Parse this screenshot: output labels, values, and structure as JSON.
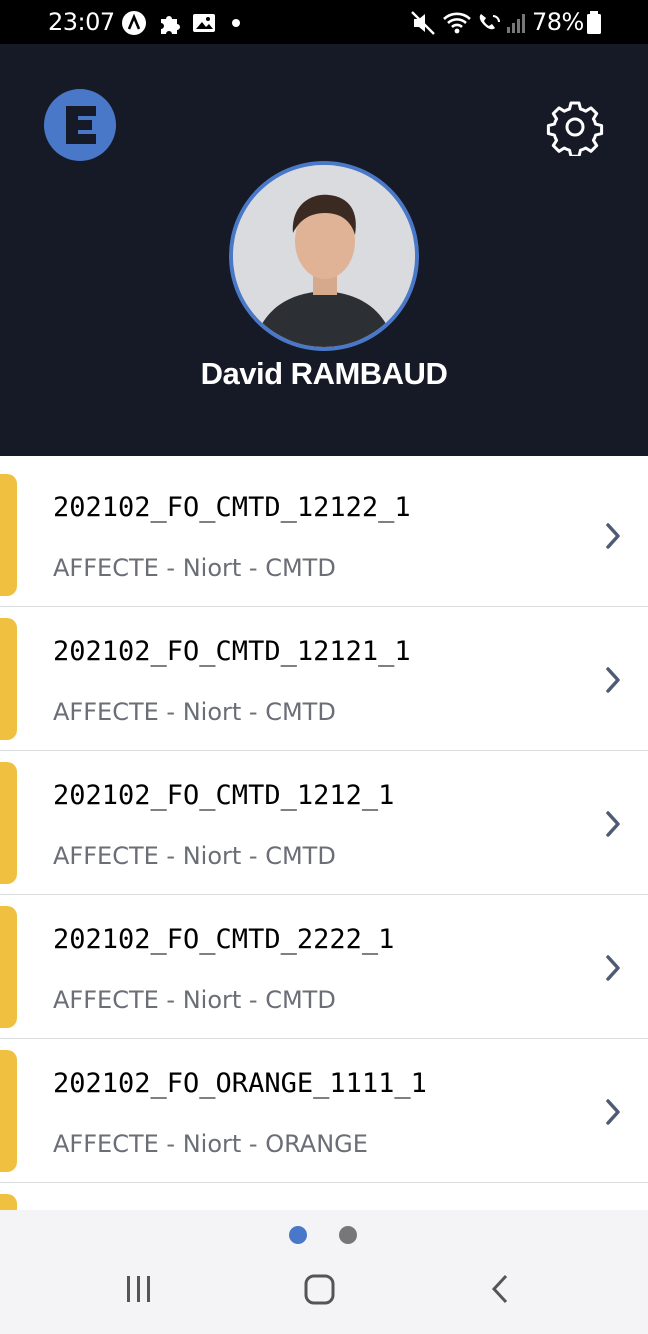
{
  "status_bar": {
    "time": "23:07",
    "battery_pct": "78%"
  },
  "profile": {
    "logo_letter": "E",
    "name": "David RAMBAUD"
  },
  "colors": {
    "header_bg": "#161a26",
    "accent": "#4a78c8",
    "row_indicator": "#f0c040",
    "subtitle": "#6b6e76",
    "chevron": "#4f5b70"
  },
  "list": {
    "items": [
      {
        "title": "202102_FO_CMTD_12122_1",
        "subtitle": "AFFECTE - Niort - CMTD"
      },
      {
        "title": "202102_FO_CMTD_12121_1",
        "subtitle": "AFFECTE - Niort - CMTD"
      },
      {
        "title": "202102_FO_CMTD_1212_1",
        "subtitle": "AFFECTE - Niort - CMTD"
      },
      {
        "title": "202102_FO_CMTD_2222_1",
        "subtitle": "AFFECTE - Niort - CMTD"
      },
      {
        "title": "202102_FO_ORANGE_1111_1",
        "subtitle": "AFFECTE - Niort - ORANGE"
      }
    ]
  },
  "pager": {
    "page_count": 2,
    "active_page": 1
  },
  "icons": {
    "settings": "gear-icon",
    "chevron": "chevron-right-icon",
    "nav_recents": "recents-icon",
    "nav_home": "home-icon",
    "nav_back": "back-icon"
  }
}
